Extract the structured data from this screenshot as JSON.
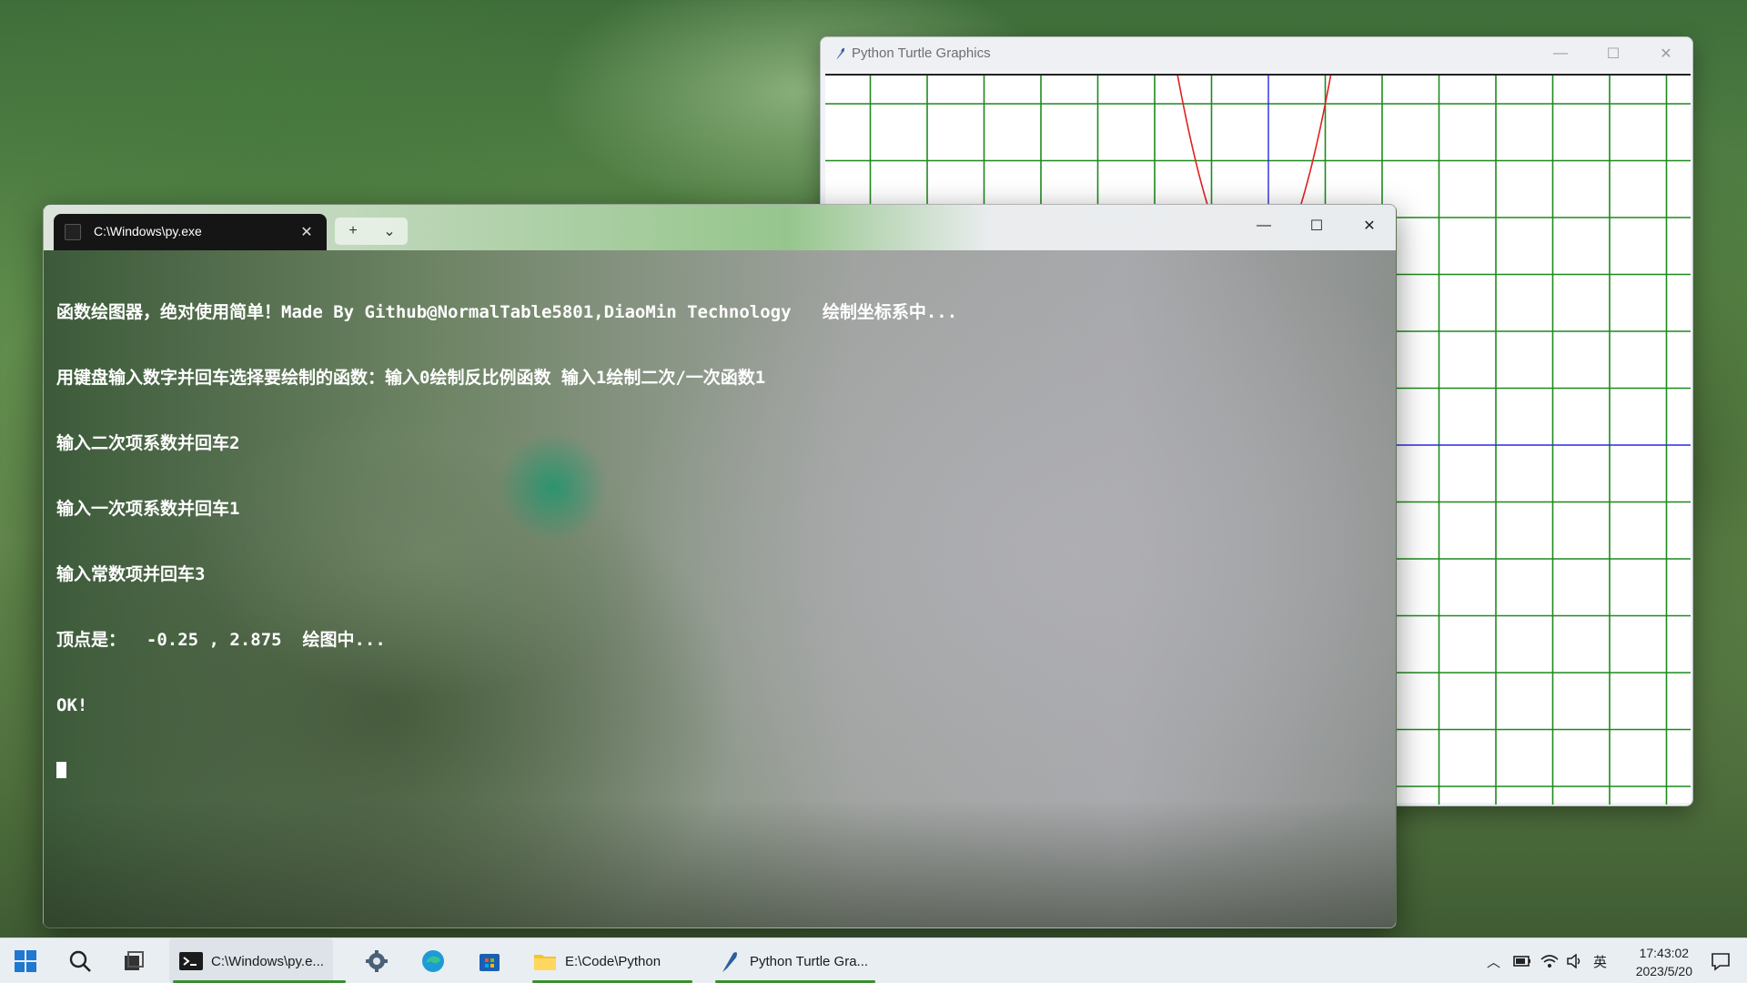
{
  "turtle_window": {
    "title": "Python Turtle Graphics",
    "controls": {
      "minimize": "—",
      "maximize": "☐",
      "close": "✕"
    },
    "grid_color": "#1e8a1e",
    "axis_color": "#2a2ae0",
    "curve_color": "#e02020"
  },
  "terminal": {
    "tab_title": "C:\\Windows\\py.exe",
    "tab_close": "✕",
    "new_tab": "+",
    "tab_dropdown": "⌄",
    "controls": {
      "minimize": "—",
      "maximize": "☐",
      "close": "✕"
    },
    "lines": [
      "函数绘图器，绝对使用简单！Made By Github@NormalTable5801,DiaoMin Technology   绘制坐标系中...",
      "用键盘输入数字并回车选择要绘制的函数：输入0绘制反比例函数 输入1绘制二次/一次函数1",
      "输入二次项系数并回车2",
      "输入一次项系数并回车1",
      "输入常数项并回车3",
      "顶点是：  -0.25 , 2.875  绘图中...",
      "OK!"
    ]
  },
  "taskbar": {
    "apps": [
      {
        "label": "C:\\Windows\\py.e...",
        "icon": "terminal-icon"
      },
      {
        "label": "E:\\Code\\Python",
        "icon": "folder-icon"
      },
      {
        "label": "Python Turtle Gra...",
        "icon": "feather-icon"
      }
    ],
    "ime": "英",
    "time": "17:43:02",
    "date": "2023/5/20"
  }
}
